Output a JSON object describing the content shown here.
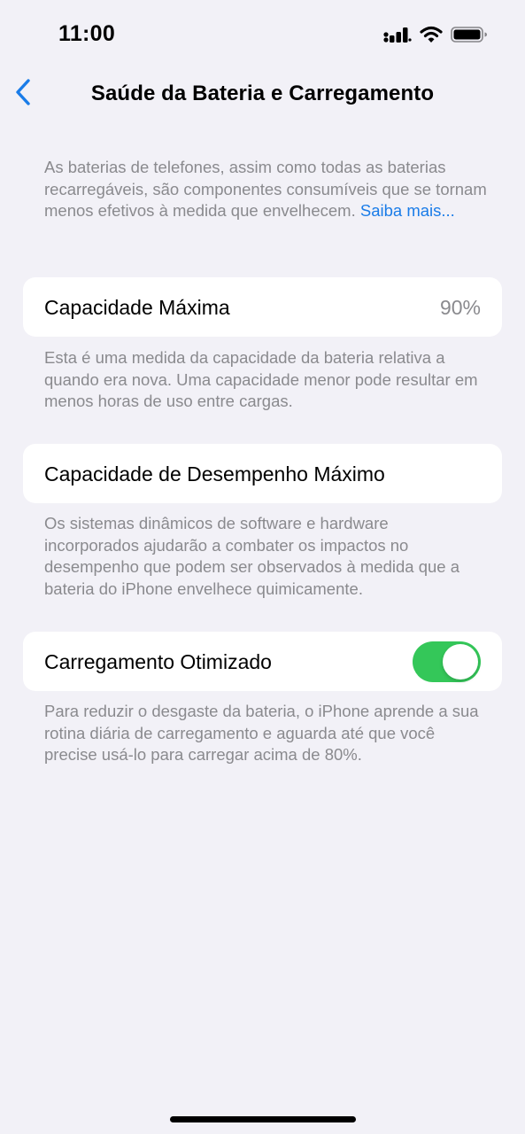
{
  "status_bar": {
    "time": "11:00",
    "icons": [
      "cellular-signal-icon",
      "wifi-icon",
      "battery-icon"
    ]
  },
  "nav": {
    "back_icon": "chevron-left-icon",
    "title": "Saúde da Bateria e Carregamento"
  },
  "intro": {
    "text": "As baterias de telefones, assim como todas as baterias recarregáveis, são componentes consumíveis que se tornam menos efetivos à medida que envelhecem.",
    "link": "Saiba mais..."
  },
  "max_capacity": {
    "label": "Capacidade Máxima",
    "value": "90%",
    "footer": "Esta é uma medida da capacidade da bateria relativa a quando era nova. Uma capacidade menor pode resultar em menos horas de uso entre cargas."
  },
  "peak_performance": {
    "label": "Capacidade de Desempenho Máximo",
    "footer": "Os sistemas dinâmicos de software e hardware incorporados ajudarão a combater os impactos no desempenho que podem ser observados à medida que a bateria do iPhone envelhece quimicamente."
  },
  "optimized_charging": {
    "label": "Carregamento Otimizado",
    "enabled": true,
    "footer": "Para reduzir o desgaste da bateria, o iPhone aprende a sua rotina diária de carregamento e aguarda até que você precise usá-lo para carregar acima de 80%."
  },
  "colors": {
    "background": "#f2f1f7",
    "accent": "#1a7ce8",
    "toggle_on": "#34c759",
    "secondary_text": "#8a8a8e"
  }
}
